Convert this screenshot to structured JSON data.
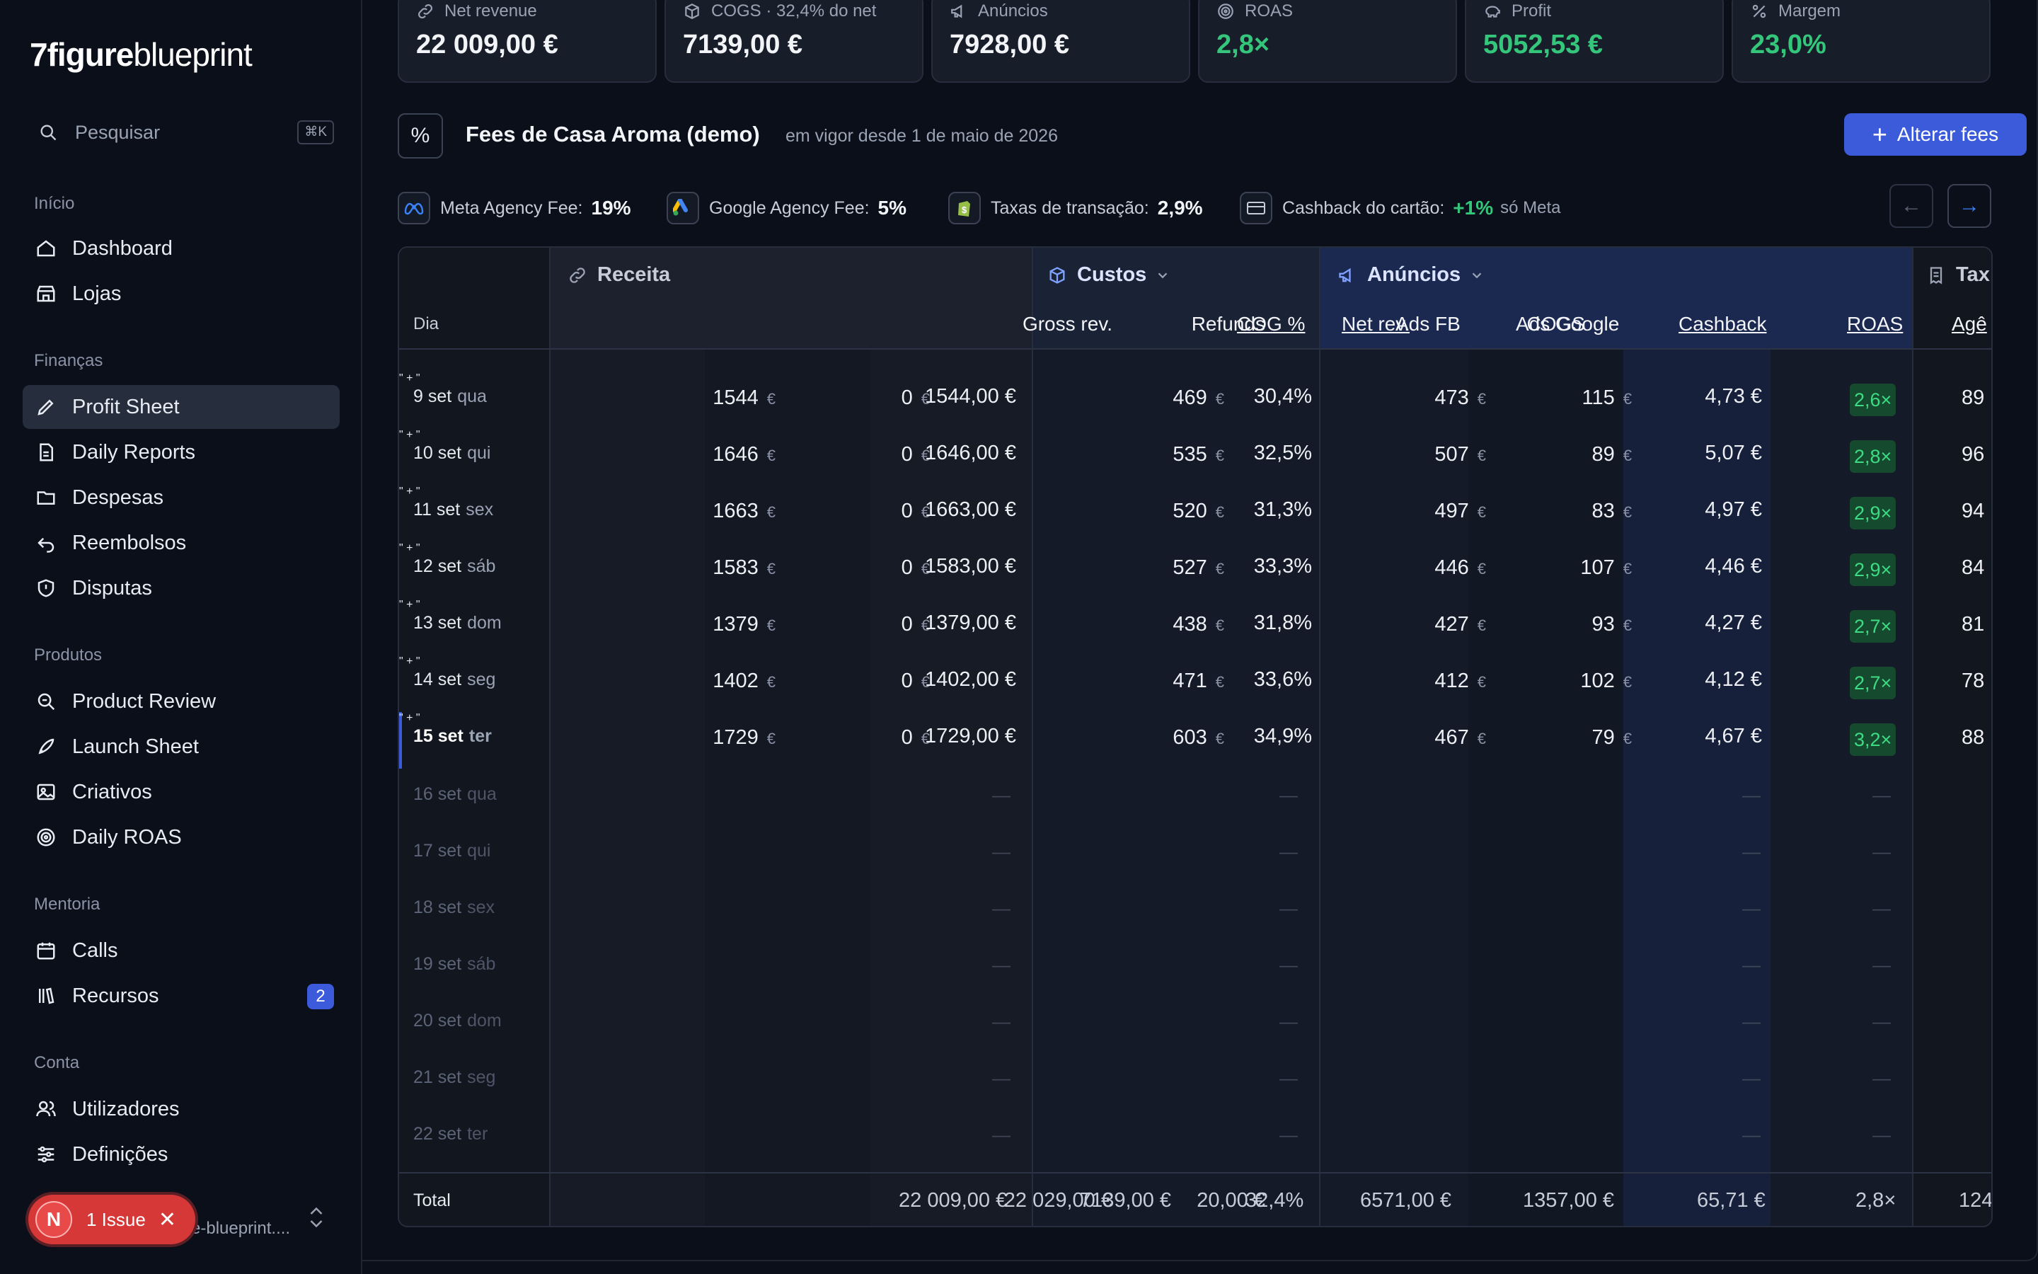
{
  "app": {
    "logo_bold": "7figure",
    "logo_light": "blueprint"
  },
  "search": {
    "label": "Pesquisar",
    "shortcut": "⌘K"
  },
  "nav": {
    "inicio": {
      "title": "Início",
      "items": [
        "Dashboard",
        "Lojas"
      ]
    },
    "financas": {
      "title": "Finanças",
      "items": [
        "Profit Sheet",
        "Daily Reports",
        "Despesas",
        "Reembolsos",
        "Disputas"
      ]
    },
    "produtos": {
      "title": "Produtos",
      "items": [
        "Product Review",
        "Launch Sheet",
        "Criativos",
        "Daily ROAS"
      ]
    },
    "mentoria": {
      "title": "Mentoria",
      "items": [
        "Calls",
        "Recursos"
      ],
      "recursos_badge": "2"
    },
    "conta": {
      "title": "Conta",
      "items": [
        "Utilizadores",
        "Definições"
      ]
    }
  },
  "issue": {
    "avatar": "N",
    "label": "1 Issue",
    "close": "✕"
  },
  "account": {
    "text": "e-blueprint...."
  },
  "kpis": [
    {
      "label": "Net revenue",
      "value": "22 009,00 €",
      "icon": "link-icon"
    },
    {
      "label": "COGS · 32,4% do net",
      "value": "7139,00 €",
      "icon": "box-icon"
    },
    {
      "label": "Anúncios",
      "value": "7928,00 €",
      "icon": "megaphone-icon"
    },
    {
      "label": "ROAS",
      "value": "2,8×",
      "icon": "target-icon"
    },
    {
      "label": "Profit",
      "value": "5052,53 €",
      "icon": "piggy-icon"
    },
    {
      "label": "Margem",
      "value": "23,0%",
      "icon": "percent-icon"
    }
  ],
  "fees": {
    "icon_text": "%",
    "title": "Fees de Casa Aroma (demo)",
    "subtitle": "em vigor desde 1 de maio de 2026",
    "button": "Alterar fees",
    "items": [
      {
        "label": "Meta Agency Fee:",
        "value": "19%"
      },
      {
        "label": "Google Agency Fee:",
        "value": "5%"
      },
      {
        "label": "Taxas de transação:",
        "value": "2,9%"
      },
      {
        "label": "Cashback do cartão:",
        "value": "+1%",
        "note": "só Meta"
      }
    ],
    "prev": "←",
    "next": "→"
  },
  "table": {
    "groups": {
      "receita": "Receita",
      "custos": "Custos",
      "anuncios": "Anúncios",
      "taxas": "Tax"
    },
    "headers": {
      "dia": "Dia",
      "gross": "Gross rev.",
      "refunds": "Refunds",
      "net": "Net rev.",
      "cogs": "COGS",
      "cogpct": "COG %",
      "adsfb": "Ads FB",
      "adsgoogle": "Ads Google",
      "cashback": "Cashback",
      "roas": "ROAS",
      "agencia": "Agê"
    },
    "currency": "€",
    "rows": [
      {
        "day": "9 set",
        "wd": "qua",
        "gross": "1544",
        "refunds": "0",
        "net": "1544,00 €",
        "cogs": "469",
        "cogpct": "30,4%",
        "adsfb": "473",
        "adsgoogle": "115",
        "cashback": "4,73 €",
        "roas": "2,6×",
        "agencia": "89"
      },
      {
        "day": "10 set",
        "wd": "qui",
        "gross": "1646",
        "refunds": "0",
        "net": "1646,00 €",
        "cogs": "535",
        "cogpct": "32,5%",
        "adsfb": "507",
        "adsgoogle": "89",
        "cashback": "5,07 €",
        "roas": "2,8×",
        "agencia": "96"
      },
      {
        "day": "11 set",
        "wd": "sex",
        "gross": "1663",
        "refunds": "0",
        "net": "1663,00 €",
        "cogs": "520",
        "cogpct": "31,3%",
        "adsfb": "497",
        "adsgoogle": "83",
        "cashback": "4,97 €",
        "roas": "2,9×",
        "agencia": "94"
      },
      {
        "day": "12 set",
        "wd": "sáb",
        "gross": "1583",
        "refunds": "0",
        "net": "1583,00 €",
        "cogs": "527",
        "cogpct": "33,3%",
        "adsfb": "446",
        "adsgoogle": "107",
        "cashback": "4,46 €",
        "roas": "2,9×",
        "agencia": "84"
      },
      {
        "day": "13 set",
        "wd": "dom",
        "gross": "1379",
        "refunds": "0",
        "net": "1379,00 €",
        "cogs": "438",
        "cogpct": "31,8%",
        "adsfb": "427",
        "adsgoogle": "93",
        "cashback": "4,27 €",
        "roas": "2,7×",
        "agencia": "81"
      },
      {
        "day": "14 set",
        "wd": "seg",
        "gross": "1402",
        "refunds": "0",
        "net": "1402,00 €",
        "cogs": "471",
        "cogpct": "33,6%",
        "adsfb": "412",
        "adsgoogle": "102",
        "cashback": "4,12 €",
        "roas": "2,7×",
        "agencia": "78"
      },
      {
        "day": "15 set",
        "wd": "ter",
        "gross": "1729",
        "refunds": "0",
        "net": "1729,00 €",
        "cogs": "603",
        "cogpct": "34,9%",
        "adsfb": "467",
        "adsgoogle": "79",
        "cashback": "4,67 €",
        "roas": "3,2×",
        "agencia": "88"
      }
    ],
    "empty_rows": [
      {
        "day": "16 set",
        "wd": "qua"
      },
      {
        "day": "17 set",
        "wd": "qui"
      },
      {
        "day": "18 set",
        "wd": "sex"
      },
      {
        "day": "19 set",
        "wd": "sáb"
      },
      {
        "day": "20 set",
        "wd": "dom"
      },
      {
        "day": "21 set",
        "wd": "seg"
      },
      {
        "day": "22 set",
        "wd": "ter"
      }
    ],
    "dash": "—",
    "total": {
      "label": "Total",
      "gross": "22 029,00 €",
      "refunds": "20,00 €",
      "net": "22 009,00 €",
      "cogs": "7139,00 €",
      "cogpct": "32,4%",
      "adsfb": "6571,00 €",
      "adsgoogle": "1357,00 €",
      "cashback": "65,71 €",
      "roas": "2,8×",
      "agencia": "124"
    }
  },
  "colors": {
    "accent": "#3b5bdb",
    "green": "#34c77b",
    "red": "#d63838"
  }
}
